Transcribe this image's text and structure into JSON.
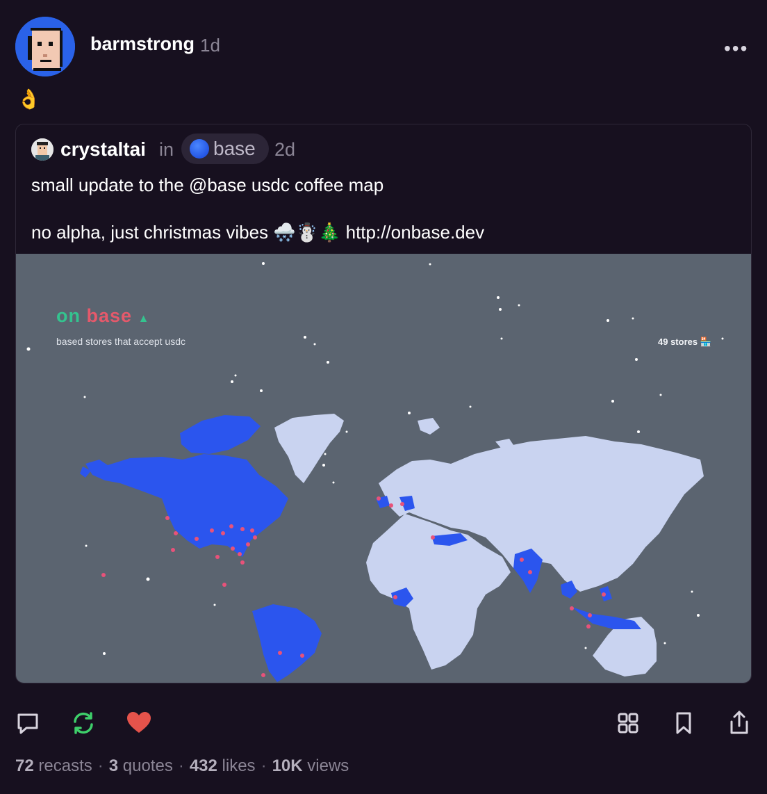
{
  "post": {
    "author": "barmstrong",
    "time": "1d",
    "text": "👌",
    "more_icon": "more-horizontal-icon"
  },
  "quote": {
    "author": "crystaltai",
    "in_label": "in",
    "channel": "base",
    "time": "2d",
    "text_line1": "small update to the @base usdc coffee map",
    "text_line2": "no alpha, just christmas vibes 🌨️☃️🎄 http://onbase.dev"
  },
  "map_image": {
    "title_part1": "on",
    "title_part2": "base",
    "title_tree": "▲",
    "subtitle": "based stores that accept usdc",
    "stores": "49 stores 🏪"
  },
  "actions": {
    "reply_icon": "comment-icon",
    "recast_icon": "recast-icon",
    "like_icon": "heart-icon",
    "grid_icon": "grid-icon",
    "bookmark_icon": "bookmark-icon",
    "share_icon": "share-icon"
  },
  "stats": {
    "recasts_count": "72",
    "recasts_label": "recasts",
    "quotes_count": "3",
    "quotes_label": "quotes",
    "likes_count": "432",
    "likes_label": "likes",
    "views_count": "10K",
    "views_label": "views",
    "separator": "·"
  },
  "colors": {
    "background": "#17101f",
    "recast_green": "#3ecf6a",
    "heart_red": "#e5534b",
    "map_background": "#5b6470",
    "land": "#c9d3f0",
    "highlight_blue": "#2b55ee"
  }
}
